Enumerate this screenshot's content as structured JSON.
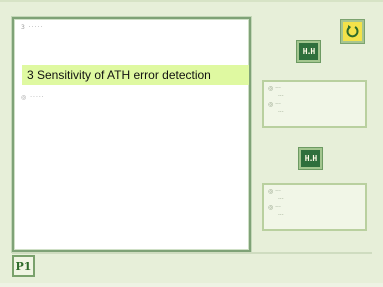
{
  "colors": {
    "background": "#e7efd9",
    "highlight": "#dff9a1",
    "green_button": "#2f6f3c",
    "yellow_button": "#f3e24a",
    "page_label": "#2e6b2a"
  },
  "list": {
    "highlighted_item": "3 Sensitivity of ATH error detection",
    "row1_glyph": "3 ·····",
    "row2_glyph": "◎ ·····"
  },
  "buttons": {
    "top_label": "H.H",
    "bottom_label": "H.H",
    "top_icon": "green-button-icon",
    "bottom_icon": "green-button-icon",
    "yellow_icon": "return-icon"
  },
  "info_top": {
    "line1": "◎ ···",
    "line2": "··· ",
    "line3": "◎ ···",
    "line4": "··· "
  },
  "info_bottom": {
    "line1": "◎ ···",
    "line2": "··· ",
    "line3": "◎ ···",
    "line4": "··· "
  },
  "page": {
    "label": "P1"
  }
}
